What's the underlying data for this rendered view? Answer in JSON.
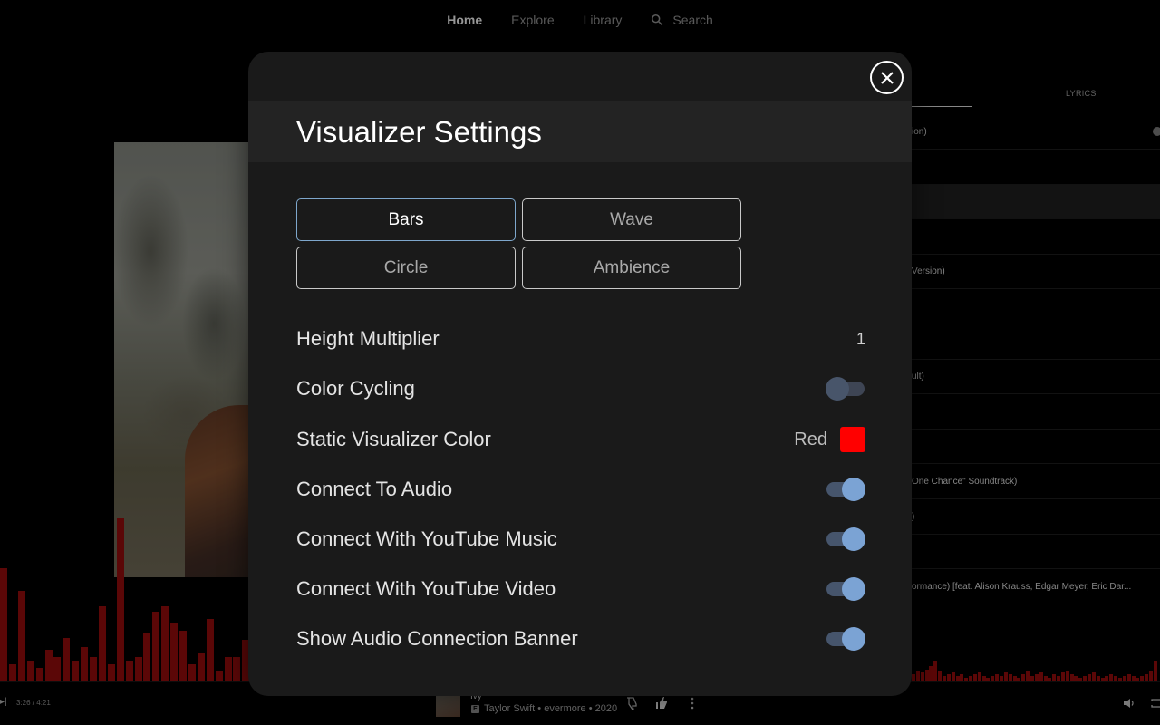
{
  "topnav": {
    "home": "Home",
    "explore": "Explore",
    "library": "Library",
    "search": "Search"
  },
  "right_panel": {
    "lyrics_tab": "LYRICS",
    "queue": [
      "ion)",
      "",
      "",
      "",
      "Version)",
      "",
      "",
      "ult)",
      "",
      "",
      "One Chance\" Soundtrack)",
      ")",
      "",
      "ormance) [feat. Alison Krauss, Edgar Meyer, Eric Dar..."
    ]
  },
  "player": {
    "left_edge": "▸|",
    "time": "3:26 / 4:21",
    "song_title": "Ivy",
    "explicit": "E",
    "song_meta": "Taylor Swift • evermore • 2020"
  },
  "visualizer": {
    "color": "#8d0b0b",
    "levels_left": [
      0.65,
      0.1,
      0.52,
      0.12,
      0.08,
      0.18,
      0.14,
      0.25,
      0.12,
      0.2,
      0.14,
      0.43,
      0.1,
      0.94,
      0.12,
      0.14,
      0.28,
      0.4,
      0.43,
      0.34,
      0.29,
      0.1,
      0.16,
      0.36,
      0.06,
      0.14,
      0.14,
      0.24
    ],
    "levels_right": [
      0.04,
      0.06,
      0.05,
      0.07,
      0.09,
      0.12,
      0.06,
      0.03,
      0.04,
      0.05,
      0.03,
      0.04,
      0.02,
      0.03,
      0.04,
      0.05,
      0.03,
      0.02,
      0.03,
      0.04,
      0.03,
      0.05,
      0.04,
      0.03,
      0.02,
      0.04,
      0.06,
      0.03,
      0.04,
      0.05,
      0.03,
      0.02,
      0.04,
      0.03,
      0.05,
      0.06,
      0.04,
      0.03,
      0.02,
      0.03,
      0.04,
      0.05,
      0.03,
      0.02,
      0.03,
      0.04,
      0.03,
      0.02,
      0.03,
      0.04,
      0.03,
      0.02,
      0.03,
      0.04,
      0.06,
      0.12
    ]
  },
  "modal": {
    "title": "Visualizer Settings",
    "types": [
      {
        "label": "Bars",
        "selected": true
      },
      {
        "label": "Wave",
        "selected": false
      },
      {
        "label": "Circle",
        "selected": false
      },
      {
        "label": "Ambience",
        "selected": false
      }
    ],
    "height_multiplier": {
      "label": "Height Multiplier",
      "value": "1"
    },
    "color_cycling": {
      "label": "Color Cycling",
      "on": false
    },
    "static_color": {
      "label": "Static Visualizer Color",
      "value": "Red",
      "swatch": "#ff0000"
    },
    "connect_audio": {
      "label": "Connect To Audio",
      "on": true
    },
    "connect_music": {
      "label": "Connect With YouTube Music",
      "on": true
    },
    "connect_video": {
      "label": "Connect With YouTube Video",
      "on": true
    },
    "show_banner": {
      "label": "Show Audio Connection Banner",
      "on": true
    }
  },
  "colors": {
    "accent": "#7ba3d4",
    "modal_bg": "#1a1a1a",
    "header_bg": "#232323"
  }
}
